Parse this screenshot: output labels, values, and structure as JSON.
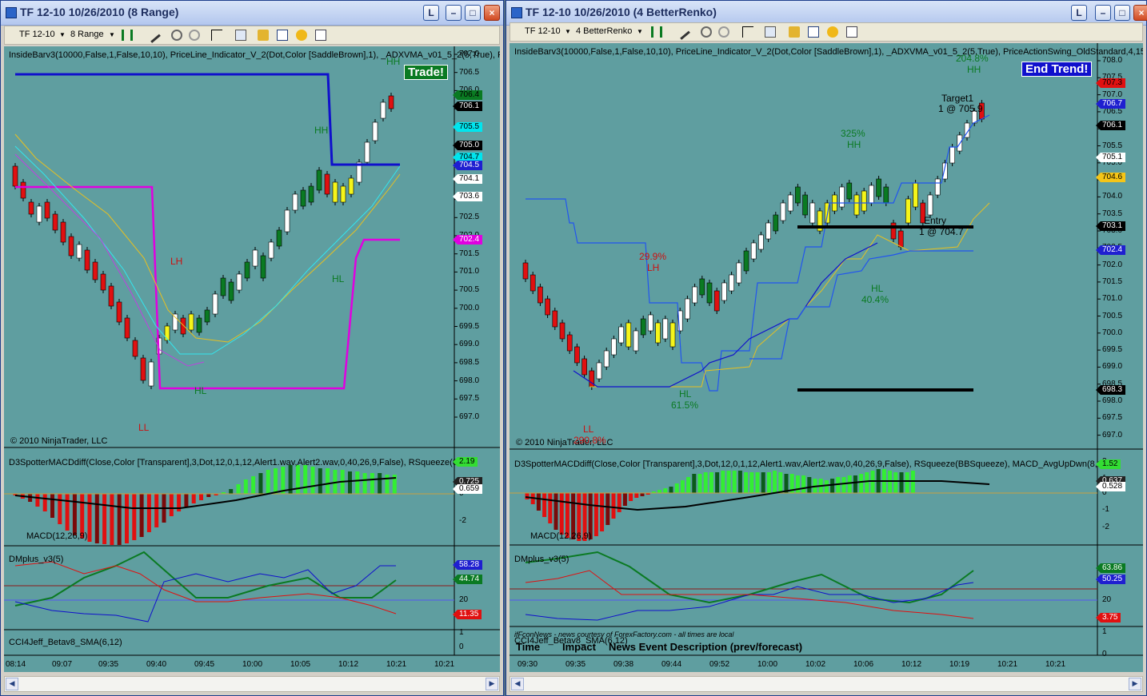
{
  "colors": {
    "chart_bg": "#5f9ea0",
    "up_bar": "#ffffff",
    "down_bar": "#e01010",
    "trend_bar": "#0a7a22",
    "inside_bar": "#f5f51a"
  },
  "windows": [
    {
      "title": "TF 12-10  10/26/2010 (8 Range)",
      "buttons": {
        "l": "L",
        "min": "–",
        "max": "□",
        "close": "×"
      },
      "toolbar": {
        "instrument": "TF 12-10",
        "period": "8 Range"
      },
      "indicator_label": "InsideBarv3(10000,False,1,False,10,10),  PriceLine_Indicator_V_2(Dot,Color [SaddleBrown],1),  _ADXVMA_v01_5_2(5,True),  P",
      "copyright": "© 2010 NinjaTrader, LLC",
      "badge": "Trade!",
      "annotations": [
        {
          "text": "HH",
          "color": "#0a7a22"
        },
        {
          "text": "HH",
          "color": "#0a7a22"
        },
        {
          "text": "LH",
          "color": "#cc1111"
        },
        {
          "text": "HL",
          "color": "#0a7a22"
        },
        {
          "text": "HL",
          "color": "#0a7a22"
        },
        {
          "text": "LL",
          "color": "#cc1111"
        }
      ],
      "price_axis": [
        "707.0",
        "706.5",
        "706.0",
        "705.5",
        "705.0",
        "704.5",
        "704.0",
        "703.5",
        "703.0",
        "702.5",
        "702.0",
        "701.5",
        "701.0",
        "700.5",
        "700.0",
        "699.5",
        "699.0",
        "698.5",
        "698.0",
        "697.5",
        "697.0"
      ],
      "price_tags": [
        {
          "text": "706.4",
          "bg": "#0a7a22",
          "fg": "#000000"
        },
        {
          "text": "706.1",
          "bg": "#000000",
          "fg": "#ffffff"
        },
        {
          "text": "705.5",
          "bg": "#00e5ee",
          "fg": "#000000"
        },
        {
          "text": "705.0",
          "bg": "#000000",
          "fg": "#ffffff"
        },
        {
          "text": "704.7",
          "bg": "#00e5ee",
          "fg": "#000000"
        },
        {
          "text": "704.5",
          "bg": "#1f1fd0",
          "fg": "#ffffff"
        },
        {
          "text": "704.1",
          "bg": "#ffffff",
          "fg": "#000000"
        },
        {
          "text": "703.6",
          "bg": "#ffffff",
          "fg": "#000000"
        },
        {
          "text": "702.4",
          "bg": "#e000e0",
          "fg": "#ffffff"
        }
      ],
      "macd_label": "D3SpotterMACDdiff(Close,Color [Transparent],3,Dot,12,0,1,12,Alert1.wav,Alert2.wav,0,40,26,9,False), RSqueeze(6",
      "macd_name": "MACD(12,26,9)",
      "macd_axis": [
        "2",
        "0",
        "-2"
      ],
      "macd_tags": [
        {
          "text": "2.19",
          "bg": "#33dd33",
          "fg": "#000000"
        },
        {
          "text": "0.725",
          "bg": "#222222",
          "fg": "#ffffff"
        },
        {
          "text": "0.659",
          "bg": "#ffffff",
          "fg": "#000000"
        }
      ],
      "dm_label": "DMplus_v3(5)",
      "dm_axis": [
        "20"
      ],
      "dm_tags": [
        {
          "text": "58.28",
          "bg": "#1f1fd0",
          "fg": "#ffffff"
        },
        {
          "text": "44.74",
          "bg": "#0a7a22",
          "fg": "#ffffff"
        },
        {
          "text": "11.35",
          "bg": "#e01010",
          "fg": "#ffffff"
        }
      ],
      "cci_label": "CCI4Jeff_Betav8_SMA(6,12)",
      "cci_axis": [
        "1",
        "0"
      ],
      "time_axis": [
        "08:14",
        "09:07",
        "09:35",
        "09:40",
        "09:45",
        "10:00",
        "10:05",
        "10:12",
        "10:21",
        "10:21"
      ]
    },
    {
      "title": "TF 12-10  10/26/2010 (4 BetterRenko)",
      "buttons": {
        "l": "L",
        "min": "–",
        "max": "□",
        "close": "×"
      },
      "toolbar": {
        "instrument": "TF 12-10",
        "period": "4 BetterRenko"
      },
      "indicator_label": "InsideBarv3(10000,False,1,False,10,10),  PriceLine_Indicator_V_2(Dot,Color [SaddleBrown],1),  _ADXVMA_v01_5_2(5,True), PriceActionSwing_OldStandard,4,15",
      "copyright": "© 2010 NinjaTrader, LLC",
      "badge": "End Trend!",
      "annotations": [
        {
          "text": "204.8%",
          "color": "#0a7a22"
        },
        {
          "text": "HH",
          "color": "#0a7a22"
        },
        {
          "text": "Target1",
          "color": "#000000"
        },
        {
          "text": "1 @ 705.9",
          "color": "#000000"
        },
        {
          "text": "325%",
          "color": "#0a7a22"
        },
        {
          "text": "HH",
          "color": "#0a7a22"
        },
        {
          "text": "Entry",
          "color": "#000000"
        },
        {
          "text": "1 @ 704.7",
          "color": "#000000"
        },
        {
          "text": "29.9%",
          "color": "#cc1111"
        },
        {
          "text": "LH",
          "color": "#cc1111"
        },
        {
          "text": "HL",
          "color": "#0a7a22"
        },
        {
          "text": "40.4%",
          "color": "#0a7a22"
        },
        {
          "text": "HL",
          "color": "#0a7a22"
        },
        {
          "text": "61.5%",
          "color": "#0a7a22"
        },
        {
          "text": "LL",
          "color": "#cc1111"
        },
        {
          "text": "290.8%",
          "color": "#cc1111"
        }
      ],
      "price_axis": [
        "708.0",
        "707.5",
        "707.0",
        "706.5",
        "706.0",
        "705.5",
        "705.0",
        "704.5",
        "704.0",
        "703.5",
        "703.0",
        "702.5",
        "702.0",
        "701.5",
        "701.0",
        "700.5",
        "700.0",
        "699.5",
        "699.0",
        "698.5",
        "698.0",
        "697.5",
        "697.0"
      ],
      "price_tags": [
        {
          "text": "707.3",
          "bg": "#e01010",
          "fg": "#000000"
        },
        {
          "text": "706.7",
          "bg": "#1f1fd0",
          "fg": "#ffffff"
        },
        {
          "text": "706.1",
          "bg": "#000000",
          "fg": "#ffffff"
        },
        {
          "text": "705.1",
          "bg": "#ffffff",
          "fg": "#000000"
        },
        {
          "text": "704.6",
          "bg": "#f5c518",
          "fg": "#000000"
        },
        {
          "text": "703.1",
          "bg": "#000000",
          "fg": "#ffffff"
        },
        {
          "text": "702.4",
          "bg": "#1f1fd0",
          "fg": "#ffffff"
        },
        {
          "text": "698.3",
          "bg": "#000000",
          "fg": "#ffffff"
        }
      ],
      "macd_label": "D3SpotterMACDdiff(Close,Color [Transparent],3,Dot,12,0,1,12,Alert1.wav,Alert2.wav,0,40,26,9,False), RSqueeze(BBSqueeze), MACD_AvgUpDwn(8,1",
      "macd_name": "MACD(12,26,9)",
      "macd_axis": [
        "2",
        "1",
        "0",
        "-1",
        "-2"
      ],
      "macd_tags": [
        {
          "text": "1.52",
          "bg": "#33dd33",
          "fg": "#000000"
        },
        {
          "text": "0.637",
          "bg": "#222222",
          "fg": "#ffffff"
        },
        {
          "text": "0.528",
          "bg": "#ffffff",
          "fg": "#000000"
        }
      ],
      "dm_label": "DMplus_v3(5)",
      "dm_axis": [
        "20"
      ],
      "dm_tags": [
        {
          "text": "63.86",
          "bg": "#0a7a22",
          "fg": "#ffffff"
        },
        {
          "text": "50.25",
          "bg": "#1f1fd0",
          "fg": "#ffffff"
        },
        {
          "text": "3.75",
          "bg": "#e01010",
          "fg": "#ffffff"
        }
      ],
      "cci_label": "CCI4Jeff_Betav8_SMA(6,12)",
      "cci_axis": [
        "1",
        "0"
      ],
      "news_source": "ifFconNews - news courtesy of ForexFactory.com - all times are local",
      "news_headers": {
        "time": "Time",
        "impact": "Impact",
        "desc": "News Event Description (prev/forecast)"
      },
      "time_axis": [
        "09:30",
        "09:35",
        "09:38",
        "09:44",
        "09:52",
        "10:00",
        "10:02",
        "10:06",
        "10:12",
        "10:19",
        "10:21",
        "10:21"
      ]
    }
  ]
}
